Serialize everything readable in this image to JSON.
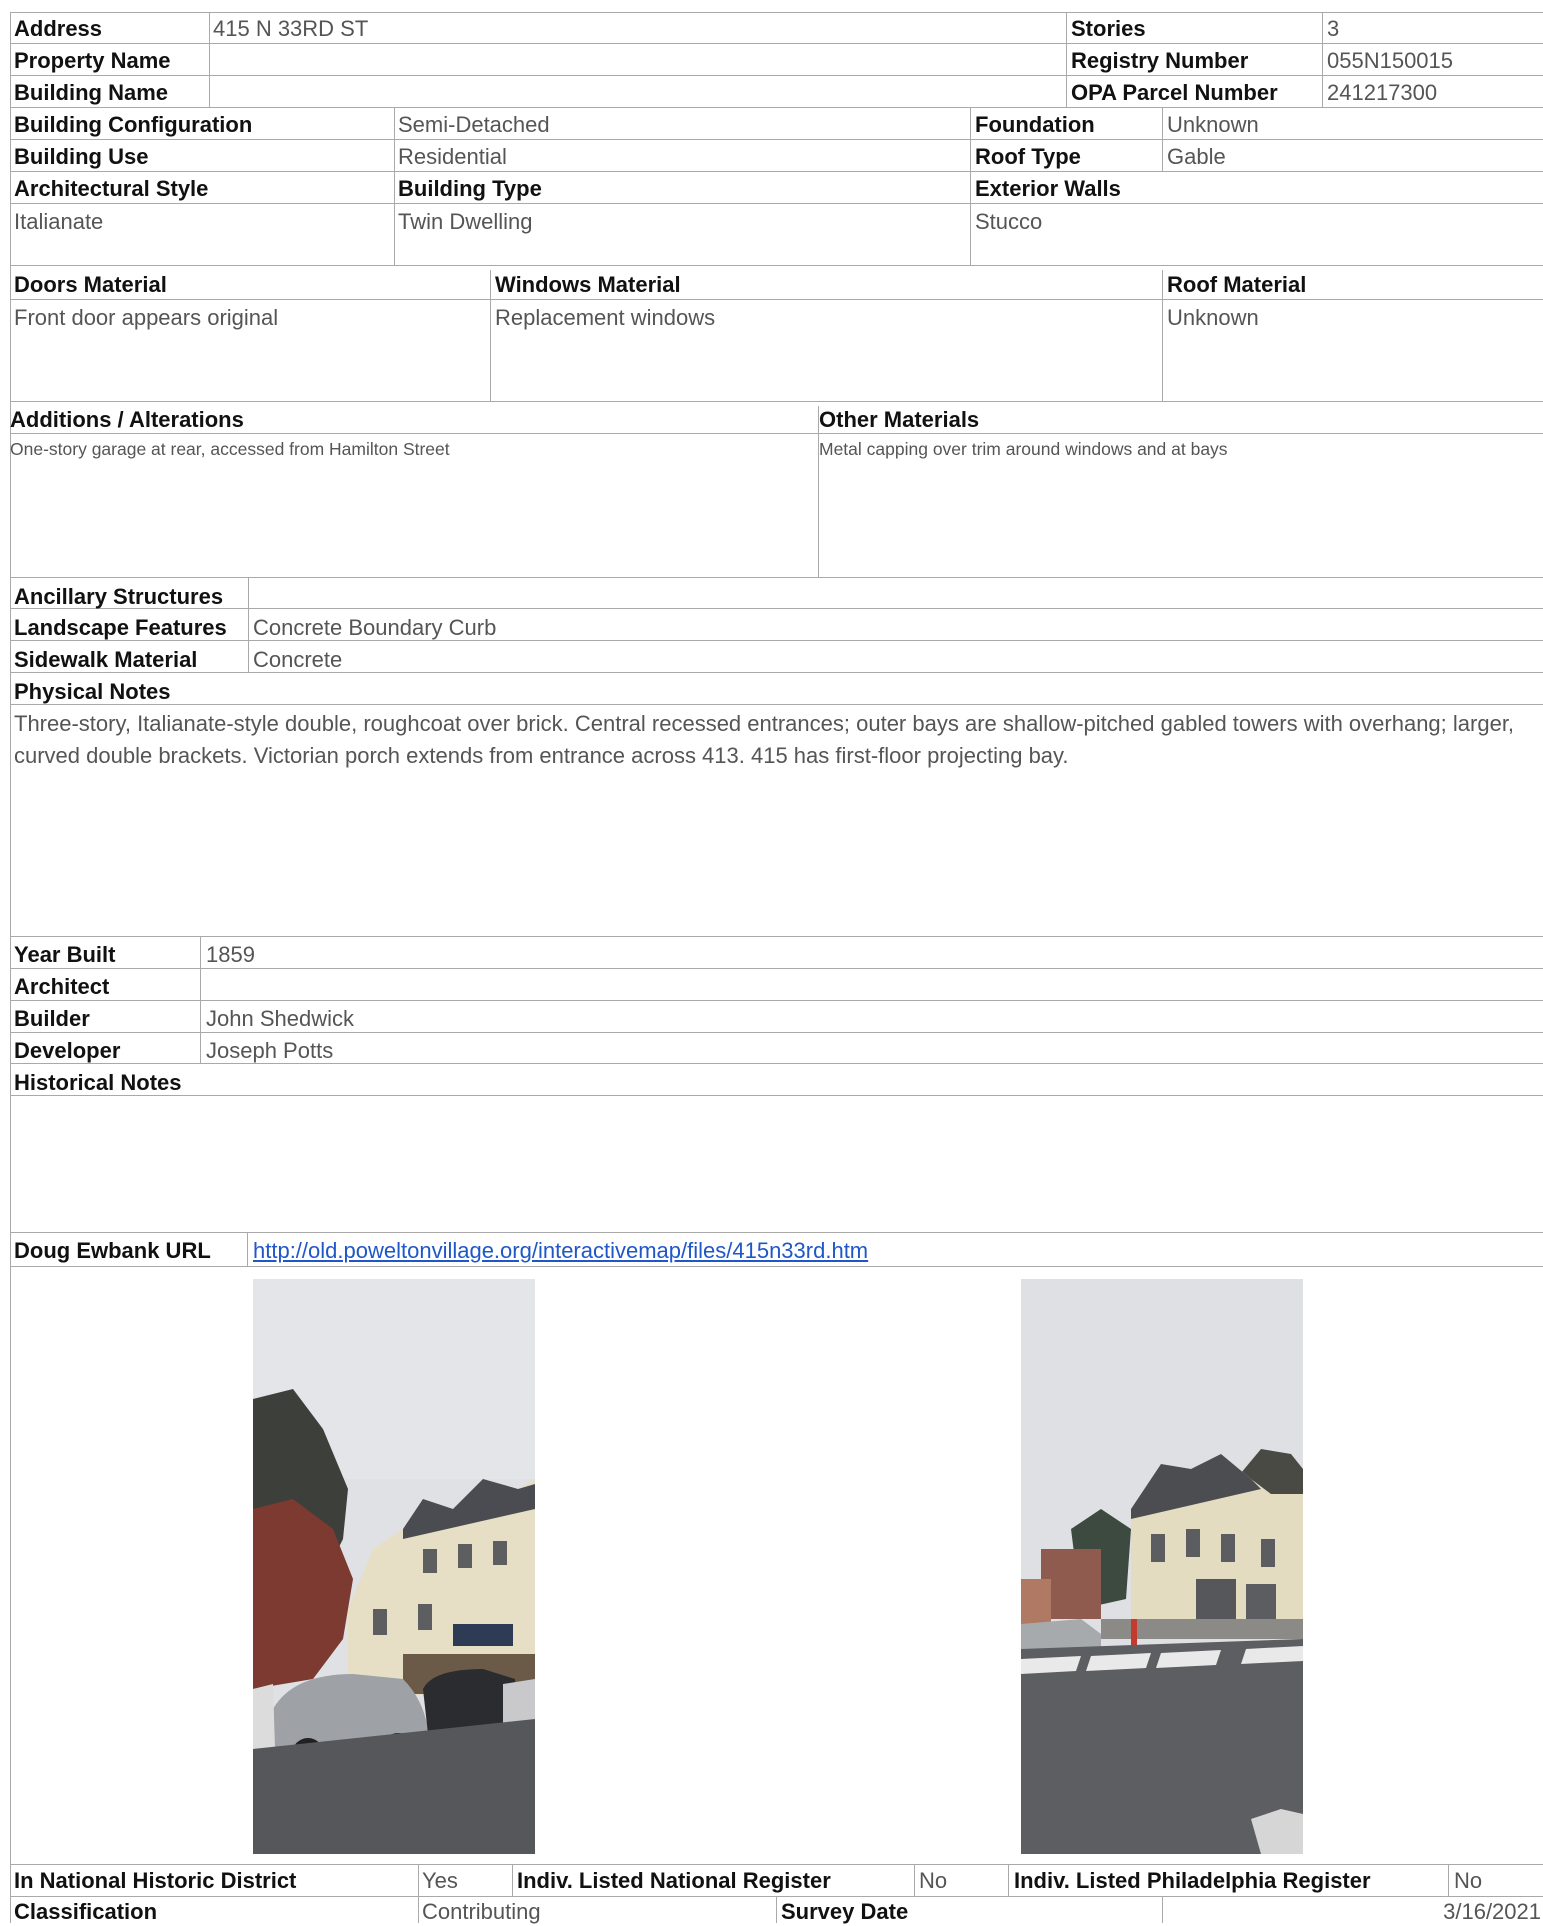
{
  "rows": {
    "address": {
      "label": "Address",
      "value": "415 N 33RD ST"
    },
    "stories": {
      "label": "Stories",
      "value": "3"
    },
    "property_name": {
      "label": "Property Name",
      "value": ""
    },
    "registry_number": {
      "label": "Registry Number",
      "value": "055N150015"
    },
    "building_name": {
      "label": "Building Name",
      "value": ""
    },
    "opa_parcel_number": {
      "label": "OPA Parcel Number",
      "value": "241217300"
    },
    "building_configuration": {
      "label": "Building Configuration",
      "value": "Semi-Detached"
    },
    "foundation": {
      "label": "Foundation",
      "value": "Unknown"
    },
    "building_use": {
      "label": "Building Use",
      "value": "Residential"
    },
    "roof_type": {
      "label": "Roof Type",
      "value": "Gable"
    },
    "architectural_style": {
      "label": "Architectural Style",
      "value": "Italianate"
    },
    "building_type": {
      "label": "Building Type",
      "value": "Twin Dwelling"
    },
    "exterior_walls": {
      "label": "Exterior Walls",
      "value": "Stucco"
    },
    "doors_material": {
      "label": "Doors Material",
      "value": "Front door appears original"
    },
    "windows_material": {
      "label": "Windows Material",
      "value": "Replacement windows"
    },
    "roof_material": {
      "label": "Roof Material",
      "value": "Unknown"
    },
    "additions_alterations": {
      "label": "Additions / Alterations",
      "value": "One-story garage at rear, accessed from Hamilton Street"
    },
    "other_materials": {
      "label": "Other Materials",
      "value": "Metal capping over trim around windows and at bays"
    },
    "ancillary_structures": {
      "label": "Ancillary Structures",
      "value": ""
    },
    "landscape_features": {
      "label": "Landscape Features",
      "value": "Concrete Boundary Curb"
    },
    "sidewalk_material": {
      "label": "Sidewalk Material",
      "value": "Concrete"
    },
    "physical_notes": {
      "label": "Physical Notes",
      "value": "Three-story, Italianate-style double, roughcoat over brick. Central recessed entrances; outer bays are shallow-pitched gabled towers with overhang; larger, curved double brackets. Victorian porch extends from entrance across 413. 415 has first-floor projecting bay."
    },
    "year_built": {
      "label": "Year Built",
      "value": "1859"
    },
    "architect": {
      "label": "Architect",
      "value": ""
    },
    "builder": {
      "label": "Builder",
      "value": "John Shedwick"
    },
    "developer": {
      "label": "Developer",
      "value": "Joseph Potts"
    },
    "historical_notes": {
      "label": "Historical Notes",
      "value": ""
    },
    "doug_ewbank_url": {
      "label": "Doug Ewbank URL",
      "value": "http://old.poweltonvillage.org/interactivemap/files/415n33rd.htm"
    },
    "in_national_historic_district": {
      "label": "In National Historic District",
      "value": "Yes"
    },
    "indiv_listed_national_register": {
      "label": "Indiv. Listed National Register",
      "value": "No"
    },
    "indiv_listed_philadelphia_register": {
      "label": "Indiv. Listed Philadelphia Register",
      "value": "No"
    },
    "classification": {
      "label": "Classification",
      "value": "Contributing"
    },
    "survey_date": {
      "label": "Survey Date",
      "value": "3/16/2021"
    }
  },
  "colors": {
    "border": "#a9a9a9",
    "label_text": "#111111",
    "value_text": "#555555",
    "link": "#1f57c8"
  }
}
